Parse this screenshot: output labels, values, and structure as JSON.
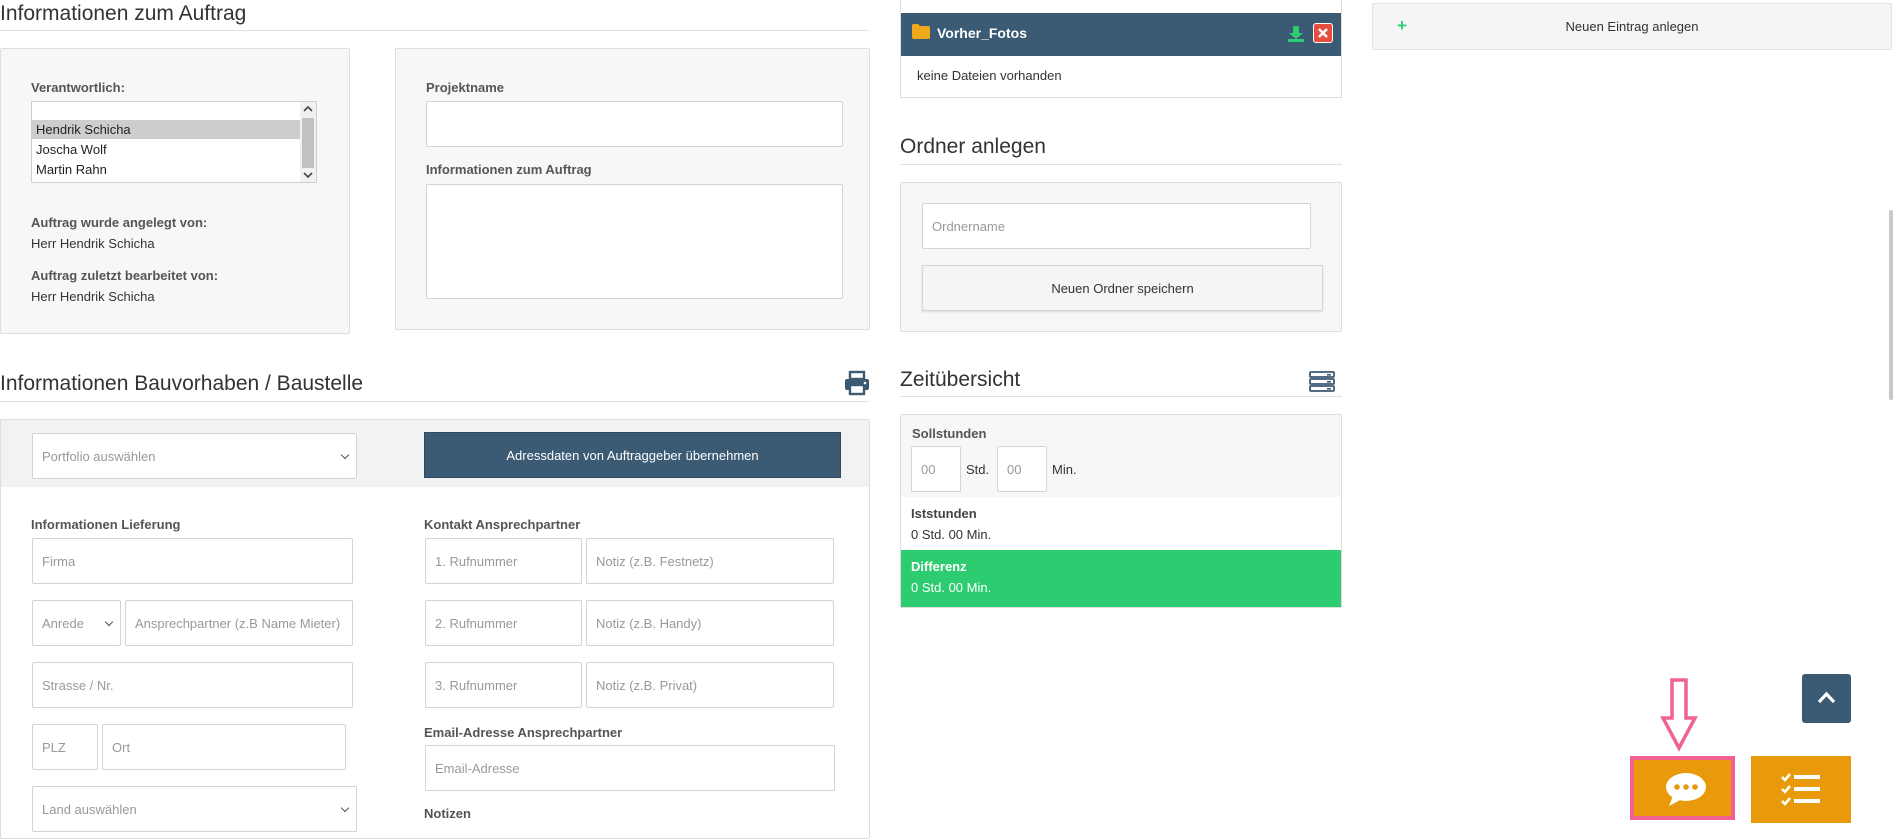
{
  "auftrag": {
    "title": "Informationen zum Auftrag",
    "verantwortlich_label": "Verantwortlich:",
    "verantwortlich_options": [
      "Hendrik Schicha",
      "Joscha Wolf",
      "Martin Rahn"
    ],
    "verantwortlich_selected": "Hendrik Schicha",
    "angelegt_label": "Auftrag wurde angelegt von:",
    "angelegt_value": "Herr Hendrik Schicha",
    "bearbeitet_label": "Auftrag zuletzt bearbeitet von:",
    "bearbeitet_value": "Herr Hendrik Schicha",
    "projektname_label": "Projektname",
    "projektname_value": "",
    "info_label": "Informationen zum Auftrag",
    "info_value": ""
  },
  "bauvorhaben": {
    "title": "Informationen Bauvorhaben / Baustelle",
    "portfolio_placeholder": "Portfolio auswählen",
    "uebernehmen_button": "Adressdaten von Auftraggeber übernehmen",
    "lieferung_label": "Informationen Lieferung",
    "firma_placeholder": "Firma",
    "anrede_placeholder": "Anrede",
    "ansprechpartner_placeholder": "Ansprechpartner (z.B Name Mieter)",
    "strasse_placeholder": "Strasse / Nr.",
    "plz_placeholder": "PLZ",
    "ort_placeholder": "Ort",
    "land_placeholder": "Land auswählen",
    "kontakt_label": "Kontakt Ansprechpartner",
    "phones": [
      {
        "number": "1. Rufnummer",
        "note": "Notiz (z.B. Festnetz)"
      },
      {
        "number": "2. Rufnummer",
        "note": "Notiz (z.B. Handy)"
      },
      {
        "number": "3. Rufnummer",
        "note": "Notiz (z.B. Privat)"
      }
    ],
    "email_label": "Email-Adresse Ansprechpartner",
    "email_placeholder": "Email-Adresse",
    "notizen_label": "Notizen"
  },
  "files": {
    "folder_name": "Vorher_Fotos",
    "empty_text": "keine Dateien vorhanden"
  },
  "ordner": {
    "title": "Ordner anlegen",
    "name_placeholder": "Ordnername",
    "save_button": "Neuen Ordner speichern"
  },
  "zeit": {
    "title": "Zeitübersicht",
    "soll_label": "Sollstunden",
    "soll_hours_placeholder": "00",
    "std_unit": "Std.",
    "soll_min_placeholder": "00",
    "min_unit": "Min.",
    "ist_label": "Iststunden",
    "ist_value": "0 Std. 00 Min.",
    "diff_label": "Differenz",
    "diff_value": "0 Std. 00 Min.",
    "diff_color": "#2ecc71"
  },
  "right": {
    "new_entry_icon": "+",
    "new_entry_label": "Neuen Eintrag anlegen"
  },
  "colors": {
    "accent_dark": "#3b5a73",
    "orange": "#e99a0a",
    "highlight_pink": "#f06292",
    "green": "#2ecc71"
  }
}
